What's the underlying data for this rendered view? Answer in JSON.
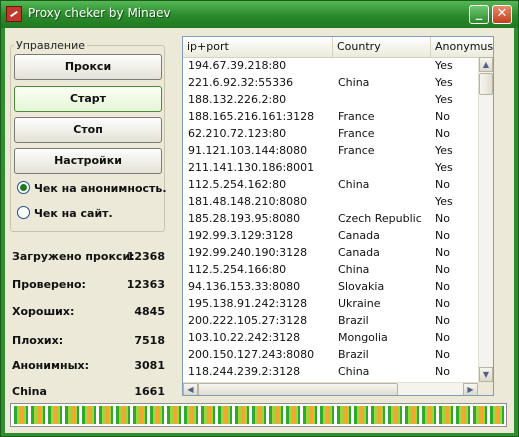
{
  "window": {
    "title": "Proxy cheker by Minaev",
    "minimize_glyph": "_",
    "close_glyph": "✕",
    "icon": "app-icon"
  },
  "control_group": {
    "label": "Управление"
  },
  "buttons": {
    "proxy": "Прокси",
    "start": "Старт",
    "stop": "Стоп",
    "settings": "Настройки"
  },
  "radio": {
    "anonymity": "Чек на анонимность.",
    "site": "Чек на сайт.",
    "selected": "anonymity"
  },
  "stats": [
    {
      "label": "Загружено прокси:",
      "value": "12368"
    },
    {
      "label": "Проверено:",
      "value": "12363"
    },
    {
      "label": "Хороших:",
      "value": "4845"
    },
    {
      "label": "Плохих:",
      "value": "7518"
    },
    {
      "label": "Анонимных:",
      "value": "3081"
    },
    {
      "label": "China",
      "value": "1661"
    }
  ],
  "table": {
    "columns": [
      "ip+port",
      "Country",
      "Anonymus"
    ],
    "rows": [
      [
        "194.67.39.218:80",
        "",
        "Yes"
      ],
      [
        "221.6.92.32:55336",
        "China",
        "Yes"
      ],
      [
        "188.132.226.2:80",
        "",
        "Yes"
      ],
      [
        "188.165.216.161:3128",
        "France",
        "No"
      ],
      [
        "62.210.72.123:80",
        "France",
        "No"
      ],
      [
        "91.121.103.144:8080",
        "France",
        "Yes"
      ],
      [
        "211.141.130.186:8001",
        "",
        "Yes"
      ],
      [
        "112.5.254.162:80",
        "China",
        "No"
      ],
      [
        "181.48.148.210:8080",
        "",
        "Yes"
      ],
      [
        "185.28.193.95:8080",
        "Czech Republic",
        "No"
      ],
      [
        "192.99.3.129:3128",
        "Canada",
        "No"
      ],
      [
        "192.99.240.190:3128",
        "Canada",
        "No"
      ],
      [
        "112.5.254.166:80",
        "China",
        "No"
      ],
      [
        "94.136.153.33:8080",
        "Slovakia",
        "No"
      ],
      [
        "195.138.91.242:3128",
        "Ukraine",
        "No"
      ],
      [
        "200.222.105.27:3128",
        "Brazil",
        "No"
      ],
      [
        "103.10.22.242:3128",
        "Mongolia",
        "No"
      ],
      [
        "200.150.127.243:8080",
        "Brazil",
        "No"
      ],
      [
        "118.244.239.2:3128",
        "China",
        "No"
      ]
    ]
  },
  "progress": {
    "fraction": 1.0
  },
  "colors": {
    "title_bar": "#2f8f2f",
    "progress_green": "#2ea82e",
    "progress_orange": "#f0a830"
  }
}
